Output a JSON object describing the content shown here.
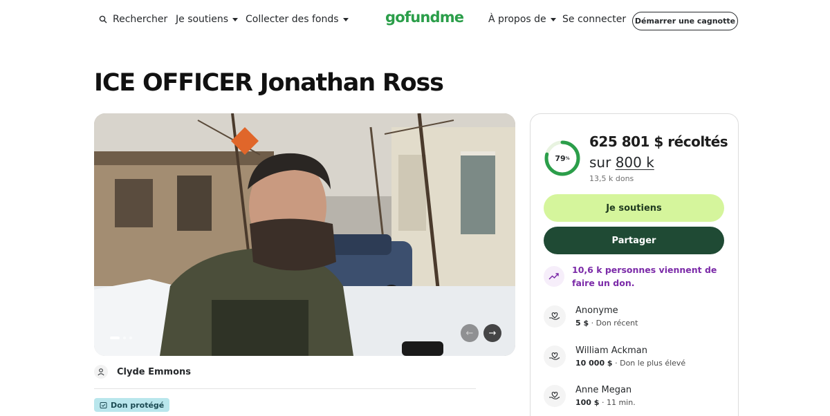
{
  "nav": {
    "search_label": "Rechercher",
    "support_label": "Je soutiens",
    "fundraise_label": "Collecter des fonds",
    "logo_text": "gofundme",
    "about_label": "À propos de",
    "login_label": "Se connecter",
    "start_label": "Démarrer une cagnotte"
  },
  "campaign": {
    "title": "ICE OFFICER Jonathan Ross",
    "organizer": "Clyde Emmons",
    "protected_label": "Don protégé",
    "carousel": {
      "slides": 3,
      "active": 1
    }
  },
  "progress": {
    "percent": 79,
    "percent_text": "79",
    "percent_sign": "%",
    "raised_text": "625 801 $ récoltés",
    "goal_prefix": "sur",
    "goal_text": "800 k",
    "donations_text": "13,5 k dons"
  },
  "actions": {
    "support_label": "Je soutiens",
    "share_label": "Partager"
  },
  "trend": {
    "text": "10,6 k personnes viennent de faire un don."
  },
  "donations": [
    {
      "name": "Anonyme",
      "amount": "5 $",
      "detail": "Don récent"
    },
    {
      "name": "William Ackman",
      "amount": "10 000 $",
      "detail": "Don le plus élevé"
    },
    {
      "name": "Anne Megan",
      "amount": "100 $",
      "detail": "11 min."
    }
  ],
  "colors": {
    "brand_green": "#2b9e4a",
    "support_button": "#d5f59c",
    "share_button": "#1f4a34",
    "trend_purple": "#7b2aa8",
    "protected_badge": "#b9e6ec"
  }
}
